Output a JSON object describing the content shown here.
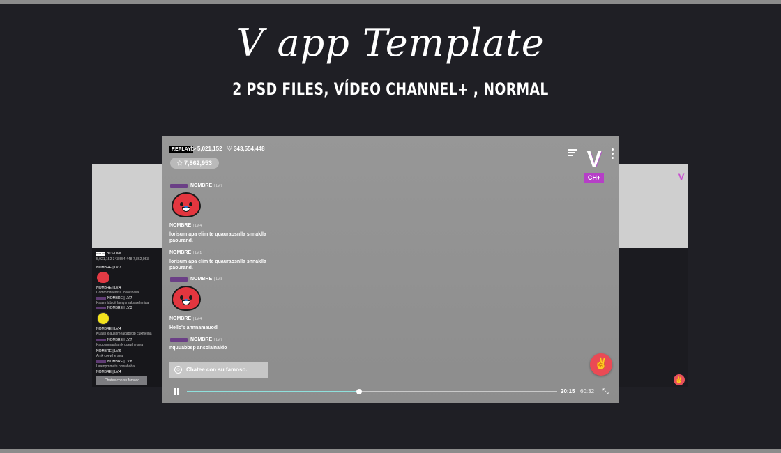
{
  "title": "V app Template",
  "subtitle": "2 PSD FILES, VÍDEO CHANNEL+ , NORMAL",
  "player": {
    "replay": "REPLAY",
    "views": "5,021,152",
    "likes": "343,554,448",
    "stars": "7,862,953",
    "channel_badge": "CH+",
    "chat": [
      {
        "user": "NOMBRE",
        "level": "| LV.7",
        "sticker": "tata"
      },
      {
        "user": "NOMBRE",
        "level": "| LV.4",
        "text": "lorisum apa elim te quauraosnlla snnaklla paourand."
      },
      {
        "user": "NOMBRE",
        "level": "| LV.1",
        "text": "lorisum apa elim te quauraosnlla snnaklla paourand."
      },
      {
        "user": "NOMBRE",
        "level": "| LV.8",
        "sticker": "tata"
      },
      {
        "user": "NOMBRE",
        "level": "| LV.4",
        "text": "Hello's annnamauodl"
      },
      {
        "user": "NOMBRE",
        "level": "| LV.7",
        "text": "nquuabbsp ansolainaldo"
      }
    ],
    "chat_placeholder": "Chatee con su famoso.",
    "current_time": "20:15",
    "total_time": "60:32",
    "progress": 0.465
  },
  "background_template": {
    "replay": "REPLAY",
    "title": "BTS Live",
    "stats": "5,021,152   343,554,448   7,862,953",
    "chat_placeholder": "Chatee con su famoso."
  },
  "colors": {
    "accent_purple": "#b63fc7",
    "heart_red": "#ea4a55",
    "progress_fill": "#8fe0dc"
  }
}
